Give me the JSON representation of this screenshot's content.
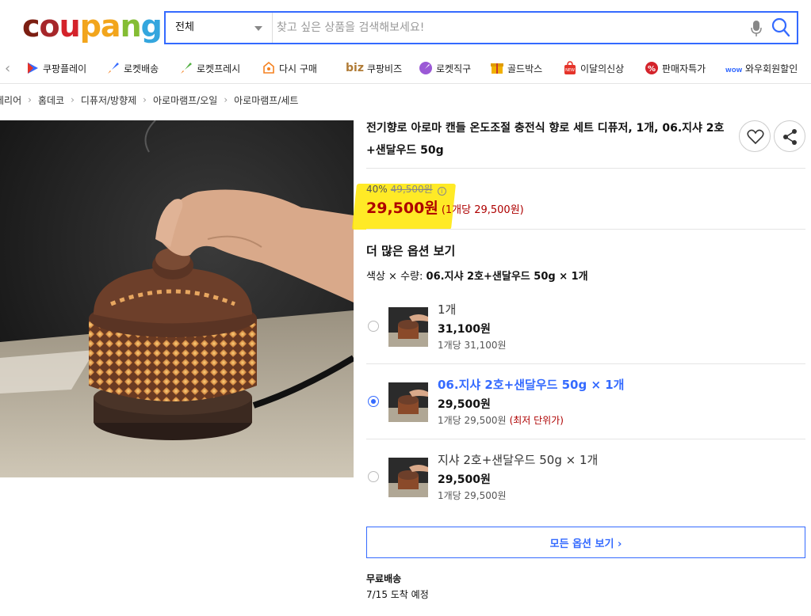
{
  "logo": {
    "text": "coupang"
  },
  "search": {
    "category": "전체",
    "placeholder": "찾고 싶은 상품을 검색해보세요!"
  },
  "nav": {
    "items": [
      {
        "label": "쿠팡플레이",
        "icon": "play-icon"
      },
      {
        "label": "로켓배송",
        "icon": "rocket-icon"
      },
      {
        "label": "로켓프레시",
        "icon": "rocket-fresh-icon"
      },
      {
        "label": "다시 구매",
        "icon": "rebuy-icon"
      },
      {
        "label": "쿠팡비즈",
        "icon": "biz-icon",
        "prefix": "biz"
      },
      {
        "label": "로켓직구",
        "icon": "global-rocket-icon"
      },
      {
        "label": "골드박스",
        "icon": "goldbox-icon"
      },
      {
        "label": "이달의신상",
        "icon": "new-icon"
      },
      {
        "label": "판매자특가",
        "icon": "percent-icon"
      },
      {
        "label": "와우회원할인",
        "icon": "wow-icon"
      }
    ]
  },
  "breadcrumb": [
    "테리어",
    "홈데코",
    "디퓨저/방향제",
    "아로마램프/오일",
    "아로마램프/세트"
  ],
  "product": {
    "title": "전기향로 아로마 캔들 온도조절 충전식 향로 세트 디퓨저, 1개, 06.지샤 2호+샌달우드 50g",
    "discount": "40%",
    "original_price": "49,500원",
    "price": "29,500원",
    "unit_price": "(1개당 29,500원)"
  },
  "options": {
    "heading": "더 많은 옵션 보기",
    "selection_prefix": "색상 × 수량:",
    "selection_value": "06.지샤 2호+샌달우드 50g × 1개",
    "list": [
      {
        "name": "1개",
        "price": "31,100원",
        "per": "1개당 31,100원",
        "best": "",
        "selected": false
      },
      {
        "name": "06.지샤 2호+샌달우드 50g × 1개",
        "price": "29,500원",
        "per": "1개당 29,500원",
        "best": "(최저 단위가)",
        "selected": true
      },
      {
        "name": "지샤 2호+샌달우드 50g × 1개",
        "price": "29,500원",
        "per": "1개당 29,500원",
        "best": "",
        "selected": false
      }
    ],
    "all_button": "모든 옵션 보기 ›"
  },
  "shipping": {
    "title": "무료배송",
    "date": "7/15 도착 예정"
  },
  "colors": {
    "accent": "#346aff",
    "price": "#ae0000",
    "highlight": "#ffe600"
  }
}
